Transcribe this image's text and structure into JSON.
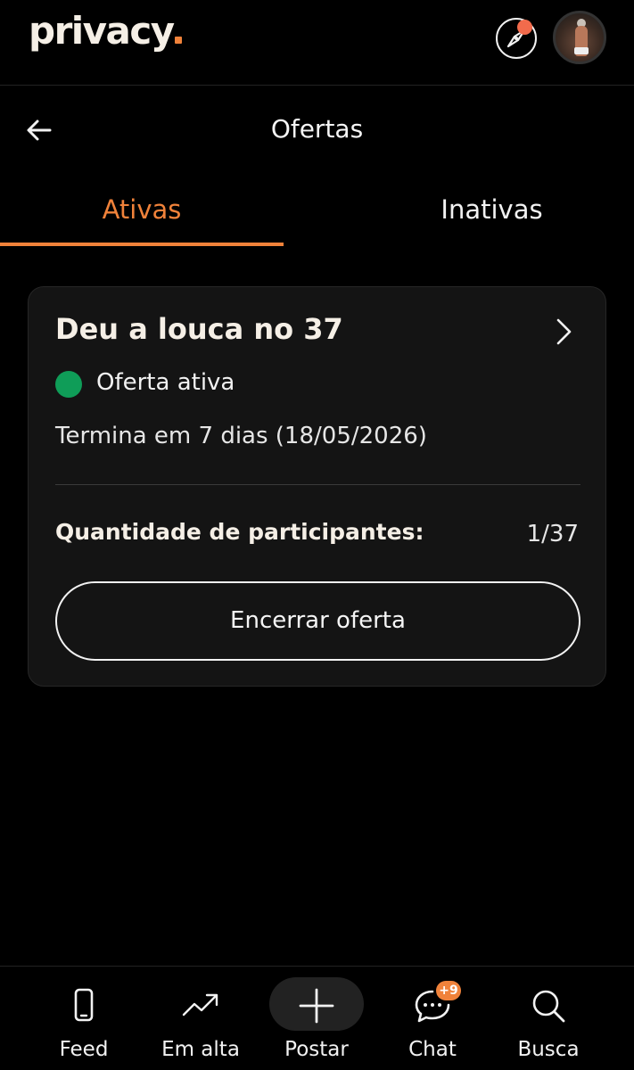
{
  "header": {
    "logo_text": "privacy",
    "accent_color": "#f0823a",
    "compass_icon": "compass-icon",
    "notification_dot_color": "#f26b4c"
  },
  "page": {
    "back_icon": "arrow-left-icon",
    "title": "Ofertas"
  },
  "tabs": [
    {
      "label": "Ativas",
      "active": true
    },
    {
      "label": "Inativas",
      "active": false
    }
  ],
  "offer_card": {
    "title": "Deu a louca no 37",
    "status_label": "Oferta ativa",
    "status_color": "#0f9d58",
    "ends_text": "Termina em 7 dias (18/05/2026)",
    "participants_label": "Quantidade de participantes:",
    "participants_value": "1/37",
    "end_button_label": "Encerrar oferta"
  },
  "bottom_nav": {
    "items": [
      {
        "label": "Feed",
        "icon": "phone-icon"
      },
      {
        "label": "Em alta",
        "icon": "trending-up-icon"
      },
      {
        "label": "Postar",
        "icon": "plus-icon"
      },
      {
        "label": "Chat",
        "icon": "chat-icon"
      },
      {
        "label": "Busca",
        "icon": "search-icon"
      }
    ],
    "chat_badge": "+9"
  }
}
